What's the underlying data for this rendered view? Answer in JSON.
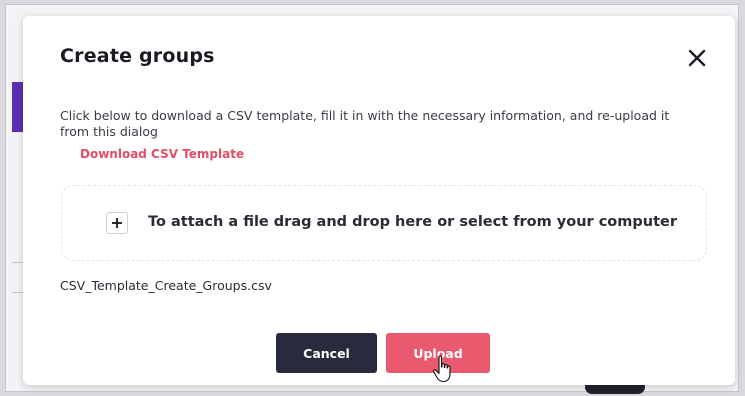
{
  "dialog": {
    "title": "Create groups",
    "close_label": "Close",
    "instructions": "Click below to download a CSV template, fill it in with the necessary information, and re-upload it from this dialog",
    "download_link": "Download CSV Template",
    "dropzone": {
      "icon": "plus-icon",
      "text": "To attach a file drag and drop here or select from your computer"
    },
    "selected_file": "CSV_Template_Create_Groups.csv",
    "buttons": {
      "cancel": "Cancel",
      "upload": "Upload"
    }
  },
  "colors": {
    "accent": "#e34d66",
    "cancel_button": "#272b3c",
    "upload_button": "#ea5a6e"
  }
}
